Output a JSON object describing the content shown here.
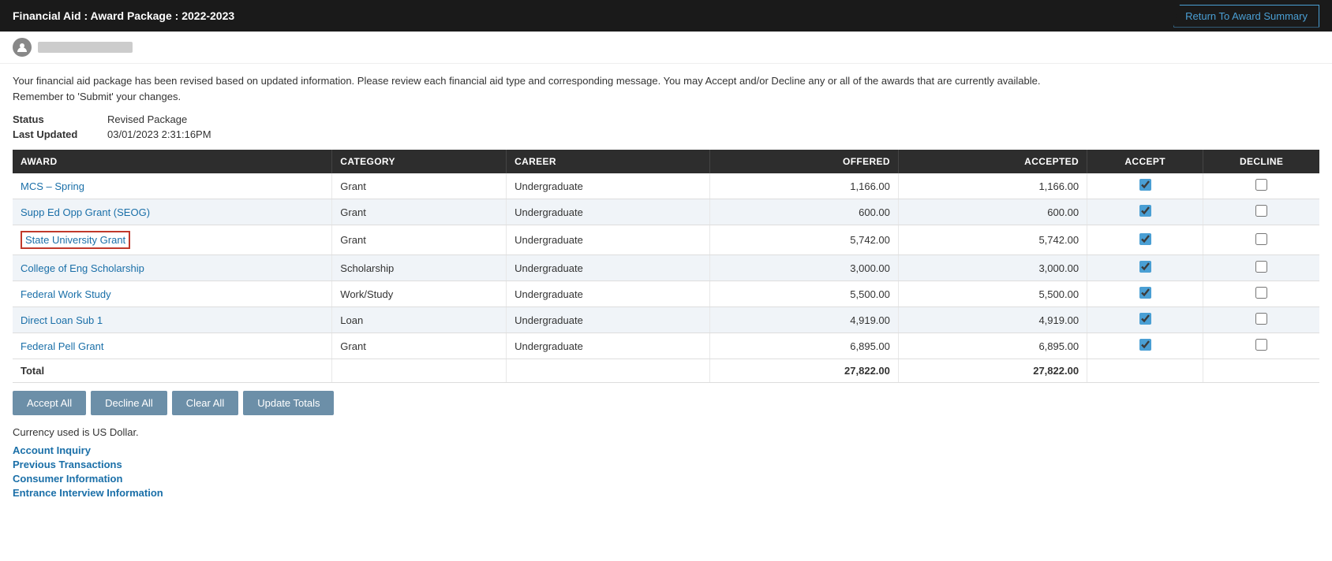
{
  "header": {
    "title": "Financial Aid : Award Package : 2022-2023",
    "return_button": "Return To Award Summary"
  },
  "notice": {
    "text1": "Your financial aid package has been revised based on updated information. Please review each financial aid type and corresponding message. You may Accept and/or Decline any or all of the awards that are currently available.",
    "text2": "Remember to 'Submit' your changes."
  },
  "status": {
    "label1": "Status",
    "value1": "Revised Package",
    "label2": "Last Updated",
    "value2": "03/01/2023  2:31:16PM"
  },
  "table": {
    "columns": [
      "AWARD",
      "CATEGORY",
      "CAREER",
      "OFFERED",
      "ACCEPTED",
      "ACCEPT",
      "DECLINE"
    ],
    "rows": [
      {
        "award": "MCS – Spring",
        "category": "Grant",
        "career": "Undergraduate",
        "offered": "1,166.00",
        "accepted": "1,166.00",
        "accept": true,
        "decline": false,
        "highlighted": false
      },
      {
        "award": "Supp Ed Opp Grant (SEOG)",
        "category": "Grant",
        "career": "Undergraduate",
        "offered": "600.00",
        "accepted": "600.00",
        "accept": true,
        "decline": false,
        "highlighted": false
      },
      {
        "award": "State University Grant",
        "category": "Grant",
        "career": "Undergraduate",
        "offered": "5,742.00",
        "accepted": "5,742.00",
        "accept": true,
        "decline": false,
        "highlighted": true
      },
      {
        "award": "College of Eng Scholarship",
        "category": "Scholarship",
        "career": "Undergraduate",
        "offered": "3,000.00",
        "accepted": "3,000.00",
        "accept": true,
        "decline": false,
        "highlighted": false
      },
      {
        "award": "Federal Work Study",
        "category": "Work/Study",
        "career": "Undergraduate",
        "offered": "5,500.00",
        "accepted": "5,500.00",
        "accept": true,
        "decline": false,
        "highlighted": false
      },
      {
        "award": "Direct Loan Sub 1",
        "category": "Loan",
        "career": "Undergraduate",
        "offered": "4,919.00",
        "accepted": "4,919.00",
        "accept": true,
        "decline": false,
        "highlighted": false
      },
      {
        "award": "Federal Pell Grant",
        "category": "Grant",
        "career": "Undergraduate",
        "offered": "6,895.00",
        "accepted": "6,895.00",
        "accept": true,
        "decline": false,
        "highlighted": false
      }
    ],
    "total_label": "Total",
    "total_offered": "27,822.00",
    "total_accepted": "27,822.00"
  },
  "buttons": {
    "accept_all": "Accept All",
    "decline_all": "Decline All",
    "clear_all": "Clear All",
    "update_totals": "Update Totals"
  },
  "currency_note": "Currency used is US Dollar.",
  "footer_links": [
    "Account Inquiry",
    "Previous Transactions",
    "Consumer Information",
    "Entrance Interview Information"
  ]
}
